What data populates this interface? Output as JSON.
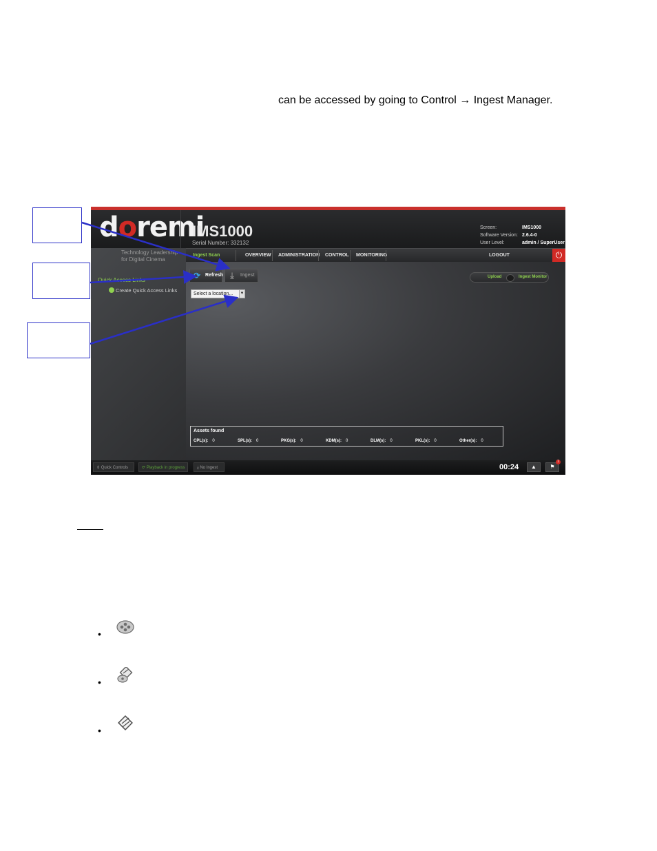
{
  "intro_text": "can be accessed by going to Control → Ingest Manager.",
  "screenshot": {
    "brand": {
      "logo_pre": "d",
      "logo_o": "o",
      "logo_post": "remi",
      "tagline": "Technology Leadership for Digital Cinema"
    },
    "device": {
      "name": "IMS1000",
      "serial": "Serial Number: 332132"
    },
    "info_labels": [
      "Screen:",
      "Software Version:",
      "User Level:"
    ],
    "info_values": [
      "IMS1000",
      "2.6.4-0",
      "admin / SuperUser"
    ],
    "nav": {
      "items": [
        "Ingest Scan",
        "OVERVIEW",
        "ADMINISTRATION",
        "CONTROL",
        "MONITORING",
        "LOGOUT"
      ],
      "active": "Ingest Scan"
    },
    "sidebar": {
      "title": "Quick Access Links",
      "link": "Create Quick Access Links"
    },
    "toolbar": {
      "refresh_label": "Refresh",
      "ingest_label": "Ingest"
    },
    "location_select": {
      "value": "Select a location..."
    },
    "toggle": {
      "left": "Upload",
      "right": "Ingest Monitor"
    },
    "assets": {
      "title": "Assets found",
      "stats": [
        {
          "label": "CPL(s):",
          "value": "0"
        },
        {
          "label": "SPL(s):",
          "value": "0"
        },
        {
          "label": "PKG(s):",
          "value": "0"
        },
        {
          "label": "KDM(s):",
          "value": "0"
        },
        {
          "label": "DLM(s):",
          "value": "0"
        },
        {
          "label": "PKL(s):",
          "value": "0"
        },
        {
          "label": "Other(s):",
          "value": "0"
        }
      ]
    },
    "footer": {
      "quick_controls": "Quick Controls",
      "playback": "Playback in progress",
      "no_ingest": "No Ingest",
      "clock": "00:24",
      "badge": "1"
    }
  },
  "bullets": [
    "•",
    "•",
    "•"
  ]
}
